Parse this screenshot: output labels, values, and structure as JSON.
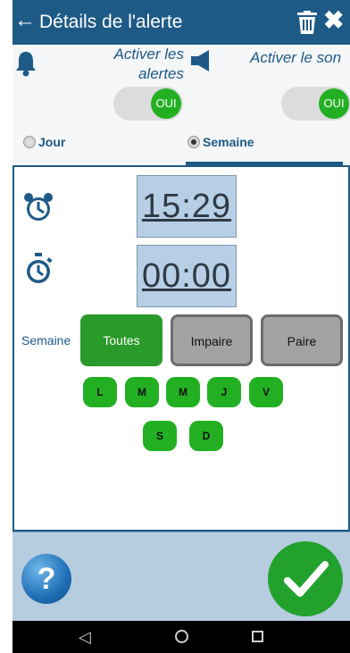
{
  "header": {
    "title": "Détails de l'alerte",
    "back_icon": "arrow-left-icon",
    "delete_icon": "trash-icon",
    "close_icon": "close-icon",
    "background": "#1e5a86"
  },
  "settings": {
    "alerts_label": "Activer les alertes",
    "sound_label": "Activer le son",
    "alerts_toggle": "OUI",
    "sound_toggle": "OUI",
    "toggle_on_color": "#22b022",
    "radio": {
      "options": [
        "Jour",
        "Semaine"
      ],
      "selected": "Semaine"
    }
  },
  "main": {
    "alarm_time": "15:29",
    "duration": "00:00",
    "week_label": "Semaine",
    "week_options": [
      {
        "label": "Toutes",
        "selected": true
      },
      {
        "label": "Impaire",
        "selected": false
      },
      {
        "label": "Paire",
        "selected": false
      }
    ],
    "days": [
      "L",
      "M",
      "M",
      "J",
      "V",
      "S",
      "D"
    ]
  },
  "bottom": {
    "help_label": "?",
    "confirm_icon": "checkmark-icon"
  },
  "android_nav": {
    "back": "◁"
  }
}
